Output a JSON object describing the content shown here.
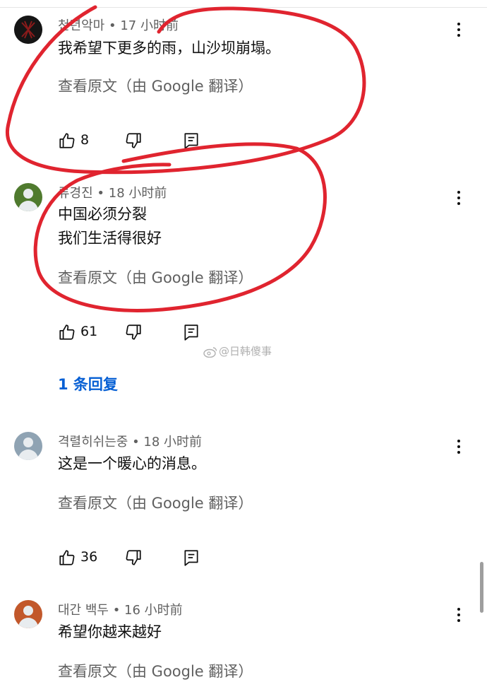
{
  "comments": [
    {
      "author": "천년악마",
      "time": "17 小时前",
      "lines": [
        "我希望下更多的雨，山沙坝崩塌。"
      ],
      "translate": "查看原文（由 Google 翻译）",
      "likes": "8"
    },
    {
      "author": "류경진",
      "time": "18 小时前",
      "lines": [
        "中国必须分裂",
        "我们生活得很好"
      ],
      "translate": "查看原文（由 Google 翻译）",
      "likes": "61"
    },
    {
      "author": "격렬히쉬는중",
      "time": "18 小时前",
      "lines": [
        "这是一个暖心的消息。"
      ],
      "translate": "查看原文（由 Google 翻译）",
      "likes": "36"
    },
    {
      "author": "대간 백두",
      "time": "16 小时前",
      "lines": [
        "希望你越来越好"
      ],
      "translate": "查看原文（由 Google 翻译）"
    }
  ],
  "separator": " • ",
  "replies_label": "1 条回复",
  "watermark": "@日韩傻事",
  "colors": {
    "annotation": "#e0242f",
    "link": "#065fd4",
    "meta": "#606060"
  },
  "icons": [
    "like-icon",
    "dislike-icon",
    "reply-icon",
    "more-vert-icon",
    "weibo-icon"
  ]
}
